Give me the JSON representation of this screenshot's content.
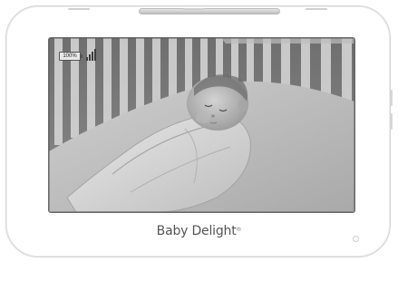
{
  "status": {
    "battery_text": "100%",
    "battery_icon": "battery-icon",
    "signal_icon": "signal-strength-icon",
    "signal_bars": 4
  },
  "feed": {
    "subject": "baby-sleeping-in-crib"
  },
  "brand": {
    "name": "Baby Delight",
    "mark": "®"
  },
  "colors": {
    "device_body": "#ffffff",
    "device_outline": "#d4d4d4",
    "screen_tone": "#7f7f7f"
  }
}
